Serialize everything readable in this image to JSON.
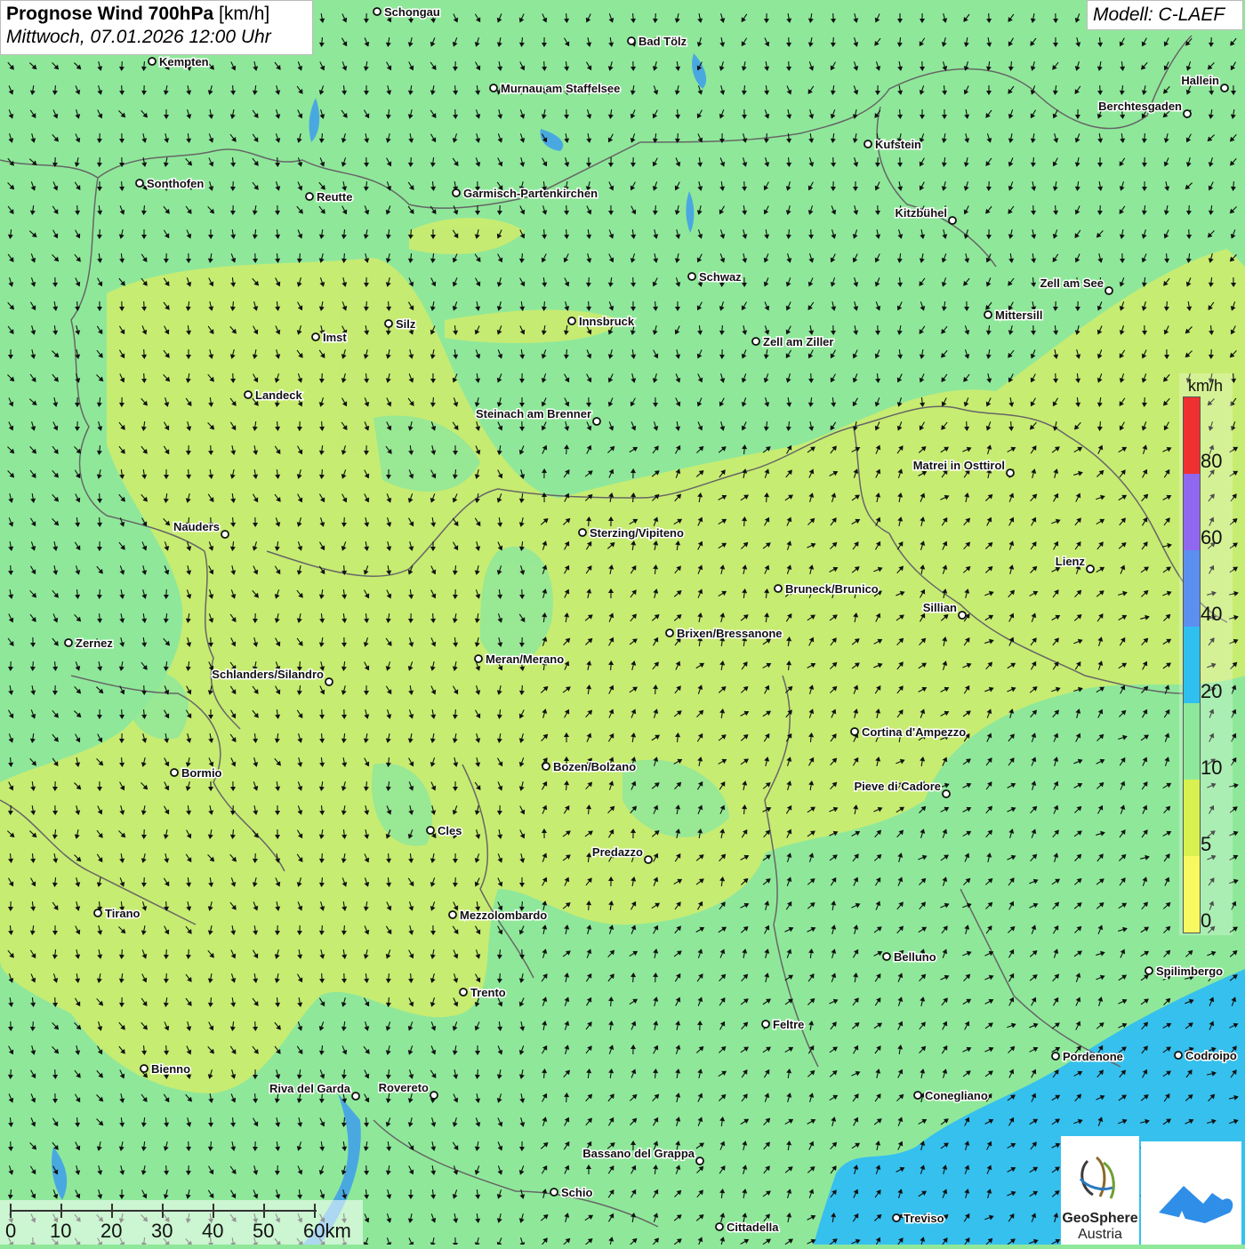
{
  "header": {
    "title_bold": "Prognose Wind 700hPa",
    "title_unit": "[km/h]",
    "subtitle": "Mittwoch, 07.01.2026 12:00 Uhr",
    "model": "Modell: C-LAEF"
  },
  "legend": {
    "unit": "km/h",
    "ticks": [
      "80",
      "60",
      "40",
      "20",
      "10",
      "5",
      "0"
    ],
    "colors": [
      "#f03030",
      "#9068f0",
      "#5c90f0",
      "#30c0f0",
      "#8ee89c",
      "#d8f050",
      "#f8f860"
    ]
  },
  "scale_bar": {
    "labels": [
      "0",
      "10",
      "20",
      "30",
      "40",
      "50",
      "60km"
    ]
  },
  "logos": {
    "geosphere_line1": "GeoSphere",
    "geosphere_line2": "Austria"
  },
  "colors": {
    "map_base": "#8fe89a",
    "yellow_zone": "#cdec6e",
    "sea": "#36c0ee",
    "lake": "#4aa8e0",
    "border": "#666666",
    "arrow": "#111111"
  },
  "cities": [
    {
      "name": "Schongau"
    },
    {
      "name": "Bad Tölz"
    },
    {
      "name": "Kempten"
    },
    {
      "name": "Murnau am Staffelsee"
    },
    {
      "name": "Hallein"
    },
    {
      "name": "Berchtesgaden"
    },
    {
      "name": "Kufstein"
    },
    {
      "name": "Sonthofen"
    },
    {
      "name": "Reutte"
    },
    {
      "name": "Garmisch-Partenkirchen"
    },
    {
      "name": "Kitzbühel"
    },
    {
      "name": "Schwaz"
    },
    {
      "name": "Zell am See"
    },
    {
      "name": "Mittersill"
    },
    {
      "name": "Innsbruck"
    },
    {
      "name": "Silz"
    },
    {
      "name": "Imst"
    },
    {
      "name": "Zell am Ziller"
    },
    {
      "name": "Landeck"
    },
    {
      "name": "Steinach am Brenner"
    },
    {
      "name": "Matrei in Osttirol"
    },
    {
      "name": "Nauders"
    },
    {
      "name": "Sterzing/Vipiteno"
    },
    {
      "name": "Lienz"
    },
    {
      "name": "Bruneck/Brunico"
    },
    {
      "name": "Sillian"
    },
    {
      "name": "Brixen/Bressanone"
    },
    {
      "name": "Zernez"
    },
    {
      "name": "Meran/Merano"
    },
    {
      "name": "Schlanders/Silandro"
    },
    {
      "name": "Cortina d'Ampezzo"
    },
    {
      "name": "Bozen/Bolzano"
    },
    {
      "name": "Bormio"
    },
    {
      "name": "Pieve di Cadore"
    },
    {
      "name": "Cles"
    },
    {
      "name": "Predazzo"
    },
    {
      "name": "Tirano"
    },
    {
      "name": "Mezzolombardo"
    },
    {
      "name": "Belluno"
    },
    {
      "name": "Spilimbergo"
    },
    {
      "name": "Trento"
    },
    {
      "name": "Feltre"
    },
    {
      "name": "Pordenone"
    },
    {
      "name": "Codroipo"
    },
    {
      "name": "Bienno"
    },
    {
      "name": "Riva del Garda"
    },
    {
      "name": "Rovereto"
    },
    {
      "name": "Conegliano"
    },
    {
      "name": "Bassano del Grappa"
    },
    {
      "name": "Schio"
    },
    {
      "name": "Treviso"
    },
    {
      "name": "Cittadella"
    }
  ]
}
